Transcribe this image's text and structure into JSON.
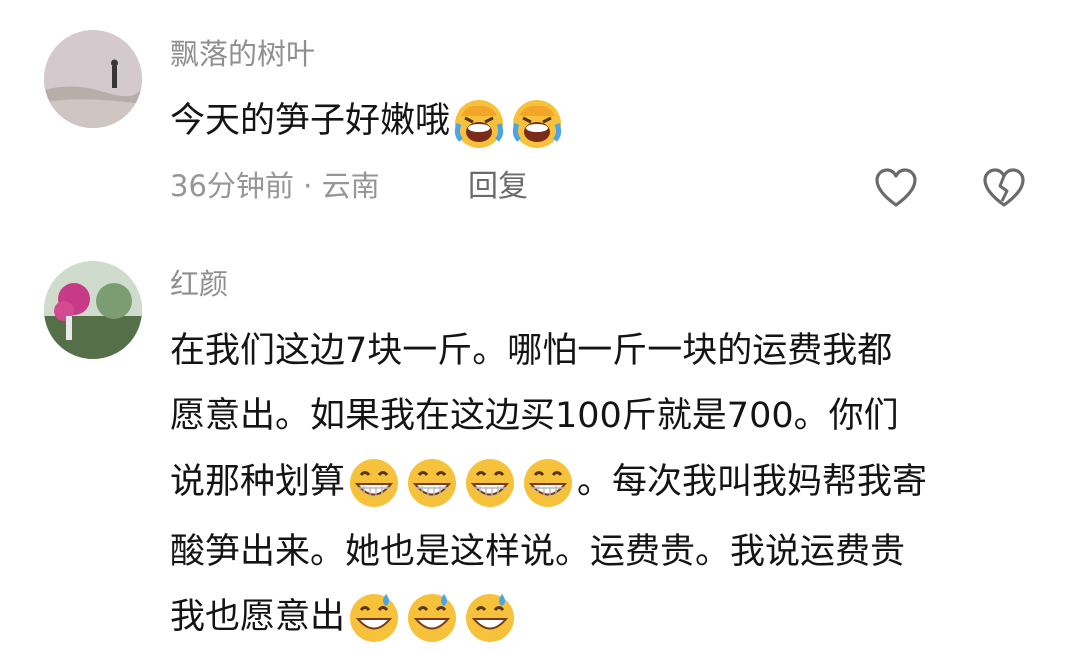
{
  "comments": [
    {
      "username": "飘落的树叶",
      "text": "今天的笋子好嫩哦",
      "emoji": [
        "laughing-crying-emoji",
        "laughing-crying-emoji"
      ],
      "time": "36分钟前",
      "separator": "·",
      "location": "云南",
      "reply_label": "回复"
    },
    {
      "username": "红颜",
      "lines": [
        "在我们这边7块一斤。哪怕一斤一块的运费我都",
        "愿意出。如果我在这边买100斤就是700。你们",
        "说那种划算",
        "。每次我叫我妈帮我寄",
        "酸笋出来。她也是这样说。运费贵。我说运费贵",
        "我也愿意出"
      ]
    }
  ],
  "icons": {
    "like": "heart-icon",
    "dislike": "broken-heart-icon"
  },
  "colors": {
    "username": "#8f8f8f",
    "text": "#141414",
    "meta": "#969696"
  }
}
